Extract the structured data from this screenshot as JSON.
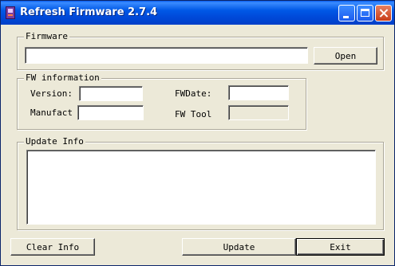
{
  "window": {
    "title": "Refresh Firmware 2.7.4"
  },
  "titlebar_buttons": {
    "minimize_icon": "minimize-icon",
    "maximize_icon": "maximize-icon",
    "close_icon": "close-icon"
  },
  "firmware_group": {
    "label": "Firmware",
    "path_value": "",
    "open_label": "Open"
  },
  "fw_info_group": {
    "label": "FW information",
    "version_label": "Version:",
    "version_value": "",
    "fwdate_label": "FWDate:",
    "fwdate_value": "",
    "manufacturer_label": "Manufactu",
    "manufacturer_value": "",
    "fwtool_label": "FW Tool",
    "fwtool_value": ""
  },
  "update_info_group": {
    "label": "Update Info",
    "log_text": ""
  },
  "buttons": {
    "clear_info": "Clear Info",
    "update": "Update",
    "exit": "Exit"
  },
  "colors": {
    "titlebar": "#0058e6",
    "window_face": "#ece9d8",
    "close_button": "#c83c18"
  }
}
